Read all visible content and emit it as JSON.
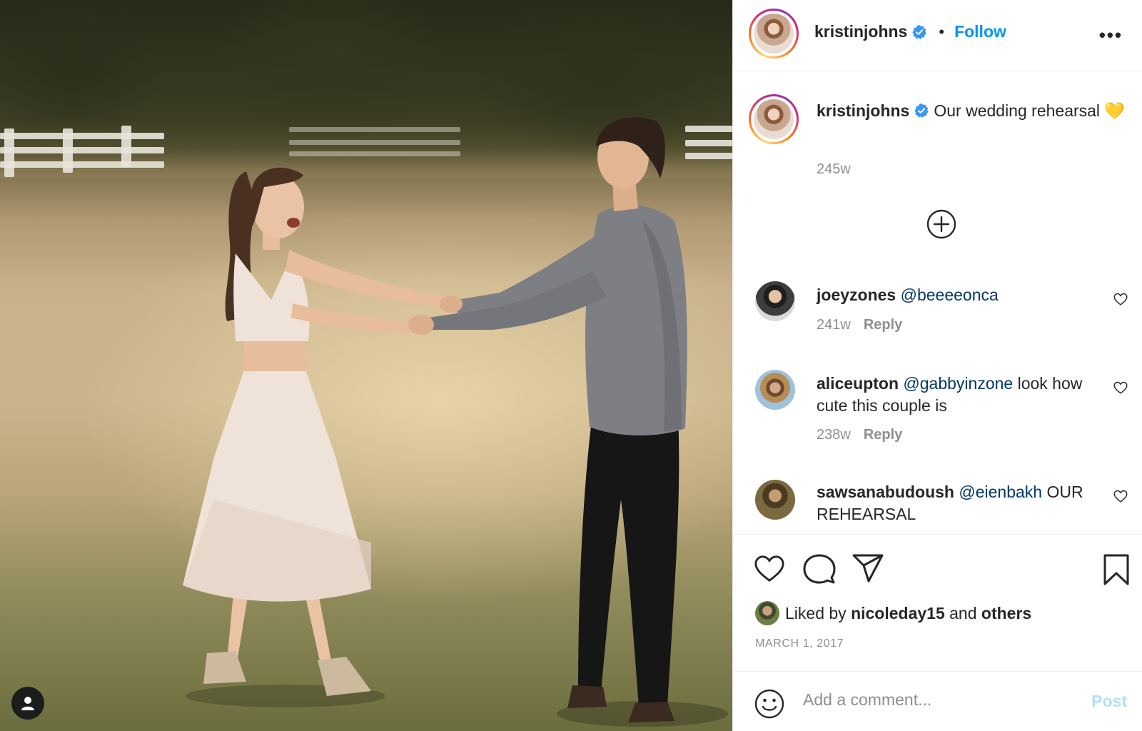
{
  "post": {
    "username": "kristinjohns",
    "follow_label": "Follow",
    "separator": "•",
    "more_label": "•••",
    "caption": "Our wedding rehearsal 💛",
    "caption_time": "245w",
    "likes_prefix": "Liked by",
    "liked_by_user": "nicoleday15",
    "likes_and": "and",
    "likes_others": "others",
    "date": "MARCH 1, 2017"
  },
  "comments": [
    {
      "username": "joeyzones",
      "mention": "@beeeeonca",
      "text": "",
      "time": "241w",
      "reply_label": "Reply"
    },
    {
      "username": "aliceupton",
      "mention": "@gabbyinzone",
      "text": "look how cute this couple is",
      "time": "238w",
      "reply_label": "Reply"
    },
    {
      "username": "sawsanabudoush",
      "mention": "@eienbakh",
      "text": "OUR REHEARSAL",
      "time": "",
      "reply_label": ""
    }
  ],
  "composer": {
    "placeholder": "Add a comment...",
    "post_label": "Post"
  },
  "icons": [
    "user-icon",
    "verified-badge-icon",
    "more-options-icon",
    "add-circle-icon",
    "heart-icon",
    "comment-icon",
    "share-icon",
    "bookmark-icon",
    "emoji-icon"
  ],
  "colors": {
    "link": "#0095f6",
    "mention": "#00376b",
    "muted": "#8e8e8e",
    "post_disabled": "#b2dffc"
  }
}
